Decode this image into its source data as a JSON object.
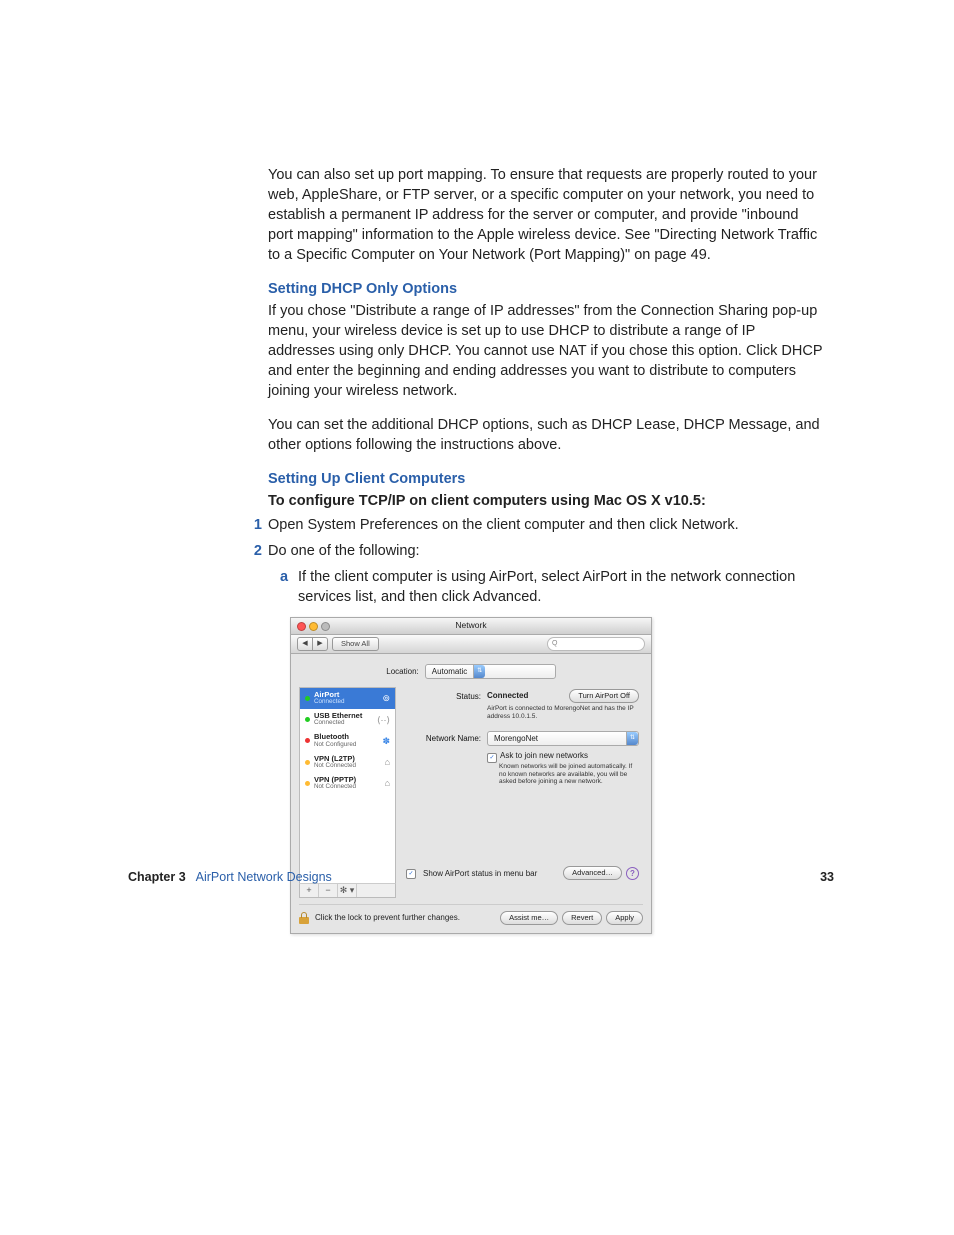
{
  "body": {
    "p1": "You can also set up port mapping. To ensure that requests are properly routed to your web, AppleShare, or FTP server, or a specific computer on your network, you need to establish a permanent IP address for the server or computer, and provide \"inbound port mapping\" information to the Apple wireless device. See \"Directing Network Traffic to a Specific Computer on Your Network (Port Mapping)\" on page 49.",
    "h1": "Setting DHCP Only Options",
    "p2": "If you chose \"Distribute a range of IP addresses\" from the Connection Sharing pop-up menu, your wireless device is set up to use DHCP to distribute a range of IP addresses using only DHCP. You cannot use NAT if you chose this option. Click DHCP and enter the beginning and ending addresses you want to distribute to computers joining your wireless network.",
    "p3": "You can set the additional DHCP options, such as DHCP Lease, DHCP Message, and other options following the instructions above.",
    "h2": "Setting Up Client Computers",
    "boldline": "To configure TCP/IP on client computers using Mac OS X v10.5:",
    "step1": "Open System Preferences on the client computer and then click Network.",
    "step2": "Do one of the following:",
    "sub_a": "If the client computer is using AirPort, select AirPort in the network connection services list, and then click Advanced.",
    "step1_num": "1",
    "step2_num": "2",
    "sub_a_letter": "a"
  },
  "footer": {
    "chapter_label": "Chapter 3",
    "chapter_title": "AirPort Network Designs",
    "page_num": "33"
  },
  "win": {
    "title": "Network",
    "showall": "Show All",
    "location_label": "Location:",
    "location_value": "Automatic",
    "sidebar": [
      {
        "name": "AirPort",
        "sub": "Connected",
        "dot": "d-g",
        "icon": "⊚",
        "sel": true
      },
      {
        "name": "USB Ethernet",
        "sub": "Connected",
        "dot": "d-g",
        "icon": "⟨··⟩"
      },
      {
        "name": "Bluetooth",
        "sub": "Not Configured",
        "dot": "d-r",
        "icon": "✽"
      },
      {
        "name": "VPN (L2TP)",
        "sub": "Not Connected",
        "dot": "d-y",
        "icon": "⌂"
      },
      {
        "name": "VPN (PPTP)",
        "sub": "Not Connected",
        "dot": "d-y",
        "icon": "⌂"
      }
    ],
    "status_label": "Status:",
    "status_value": "Connected",
    "turn_off": "Turn AirPort Off",
    "status_note": "AirPort is connected to MorengoNet and has the IP address 10.0.1.5.",
    "netname_label": "Network Name:",
    "netname_value": "MorengoNet",
    "ask_label": "Ask to join new networks",
    "ask_note": "Known networks will be joined automatically. If no known networks are available, you will be asked before joining a new network.",
    "show_status": "Show AirPort status in menu bar",
    "advanced": "Advanced…",
    "lock_text": "Click the lock to prevent further changes.",
    "assist": "Assist me…",
    "revert": "Revert",
    "apply": "Apply",
    "foot_plus": "+",
    "foot_minus": "−",
    "foot_gear": "✻ ▾",
    "search_placeholder": "Q"
  }
}
